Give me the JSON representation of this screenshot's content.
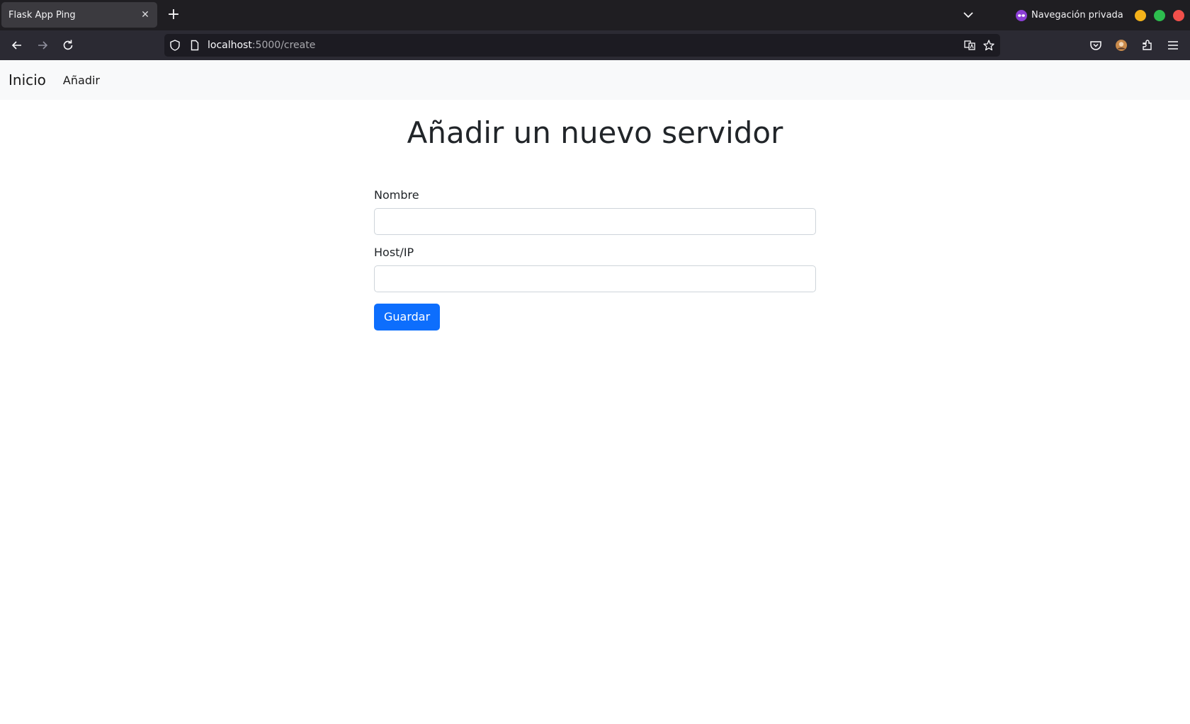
{
  "browser": {
    "tab": {
      "title": "Flask App Ping",
      "close_glyph": "✕"
    },
    "new_tab_glyph": "+",
    "private_label": "Navegación privada",
    "url": {
      "host": "localhost",
      "rest": ":5000/create"
    },
    "colors": {
      "min": "#f4b21a",
      "max": "#2dbd4e",
      "close": "#f2504b"
    }
  },
  "site": {
    "brand": "Inicio",
    "nav_link": "Añadir"
  },
  "form": {
    "title": "Añadir un nuevo servidor",
    "name_label": "Nombre",
    "name_value": "",
    "host_label": "Host/IP",
    "host_value": "",
    "submit_label": "Guardar",
    "accent": "#0d6efd"
  }
}
